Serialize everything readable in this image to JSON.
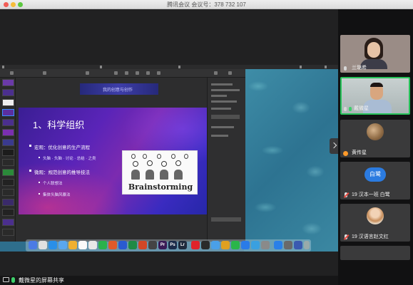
{
  "window": {
    "title": "腾讯会议 会议号：378 732 107"
  },
  "slide": {
    "top_banner": "我的创意与创作",
    "title": "1、科学组织",
    "bullets": [
      {
        "text": "宏观：优化创意的生产流程",
        "subs": [
          "头脑 · 头脑 · 讨论 · 总结 · 之类"
        ]
      },
      {
        "text": "微观：规范创意的推导技法",
        "subs": [
          "个人联想法",
          "集体头脑风暴法"
        ]
      }
    ],
    "image_word": "Brainstorming"
  },
  "dock": {
    "apps": [
      {
        "label": "Pr",
        "color": "#3a1a56"
      },
      {
        "label": "Ps",
        "color": "#1b2b4a"
      },
      {
        "label": "Lr",
        "color": "#1f2a3d"
      }
    ]
  },
  "status": {
    "share_text": "戴微星的屏幕共享"
  },
  "participants": [
    {
      "name": "兰璐希",
      "muted": false,
      "kind": "video-woman"
    },
    {
      "name": "戴微星",
      "muted": false,
      "kind": "video-man",
      "active": true
    },
    {
      "name": "黄传星",
      "muted": false,
      "kind": "avatar-photo"
    },
    {
      "name": "19 汉本一班 白鹭",
      "muted": true,
      "kind": "avatar-text",
      "avatar_text": "白鹭"
    },
    {
      "name": "19 汉语言赵文红",
      "muted": true,
      "kind": "avatar-photo"
    }
  ]
}
